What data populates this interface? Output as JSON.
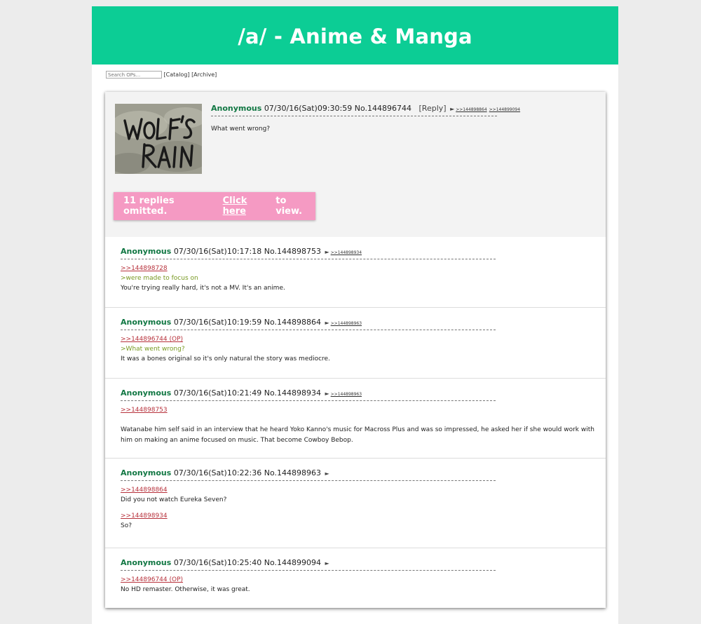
{
  "board": {
    "title": "/a/ - Anime & Manga"
  },
  "nav": {
    "search_placeholder": "Search OPs...",
    "catalog": "[Catalog]",
    "archive": "[Archive]"
  },
  "op": {
    "thumbnail_text": "WOLF'S RAIN",
    "name": "Anonymous",
    "datetime": "07/30/16(Sat)09:30:59",
    "number": "No.144896744",
    "reply_label": "[Reply]",
    "backlinks": [
      ">>144898864",
      ">>144899094"
    ],
    "message": "What went wrong?"
  },
  "omitted": {
    "prefix": "11 replies omitted.",
    "link": "Click here",
    "suffix": "to view."
  },
  "replies": [
    {
      "name": "Anonymous",
      "datetime": "07/30/16(Sat)10:17:18",
      "number": "No.144898753",
      "backlinks": [
        ">>144898934"
      ],
      "quote": ">>144898728",
      "greentext": ">were made to focus on",
      "message": "You're trying really hard, it's not a MV. It's an anime."
    },
    {
      "name": "Anonymous",
      "datetime": "07/30/16(Sat)10:19:59",
      "number": "No.144898864",
      "backlinks": [
        ">>144898963"
      ],
      "quote": ">>144896744 (OP)",
      "greentext": ">What went wrong?",
      "message": "It was a bones original so it's only natural the story was mediocre."
    },
    {
      "name": "Anonymous",
      "datetime": "07/30/16(Sat)10:21:49",
      "number": "No.144898934",
      "backlinks": [
        ">>144898963"
      ],
      "quote": ">>144898753",
      "message_line1": "Watanabe him self said in an interview that he heard Yoko Kanno's music for Macross Plus and was so impressed, he asked her if she would work with",
      "message_line2": "him on making an anime focused on music. That become Cowboy Bebop."
    },
    {
      "name": "Anonymous",
      "datetime": "07/30/16(Sat)10:22:36",
      "number": "No.144898963",
      "quote": ">>144898864",
      "message": "Did you not watch Eureka Seven?",
      "quote2": ">>144898934",
      "message2": "So?"
    },
    {
      "name": "Anonymous",
      "datetime": "07/30/16(Sat)10:25:40",
      "number": "No.144899094",
      "quote": ">>144896744 (OP)",
      "message": "No HD remaster. Otherwise, it was great."
    }
  ],
  "colors": {
    "banner": "#0ccd95",
    "name": "#117743",
    "quotelink": "#b7323c",
    "greentext": "#789922",
    "omitted_box": "#f59ac3"
  },
  "icons": {
    "backlink_marker": "triangle-right-icon"
  }
}
